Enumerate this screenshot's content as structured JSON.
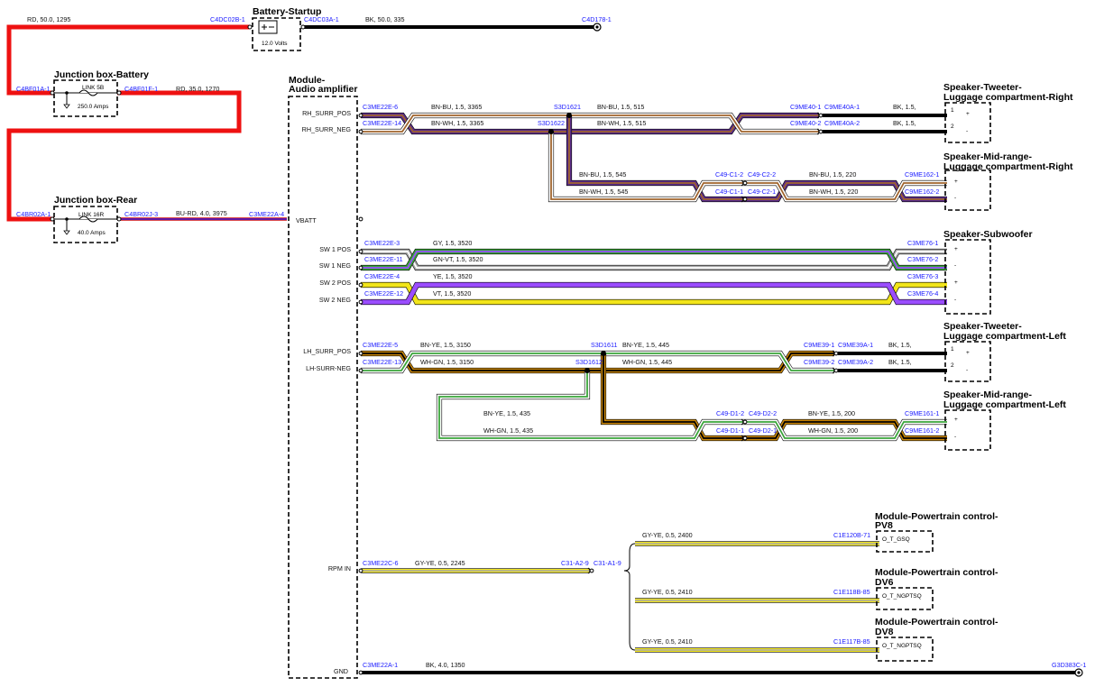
{
  "components": {
    "battery": {
      "title": "Battery-Startup",
      "rating": "12.0 Volts",
      "pin_left": "C4DC02B-1",
      "pin_right": "C4DC03A-1"
    },
    "jb_battery": {
      "title": "Junction box-Battery",
      "link": "LINK 5B",
      "rating": "250.0 Amps",
      "pin_left": "C4BF01A-1",
      "pin_right": "C4BF01F-1"
    },
    "jb_rear": {
      "title": "Junction box-Rear",
      "link": "LINK 16R",
      "rating": "40.0 Amps",
      "pin_left": "C4BR02A-1",
      "pin_right": "C4BR02J-3"
    },
    "amp": {
      "title1": "Module-",
      "title2": "Audio amplifier",
      "pins": [
        "RH_SURR_POS",
        "RH_SURR_NEG",
        "VBATT",
        "SW 1 POS",
        "SW 1 NEG",
        "SW 2 POS",
        "SW 2 NEG",
        "LH_SURR_POS",
        "LH-SURR-NEG",
        "RPM IN",
        "GND"
      ]
    },
    "spk_tw_r": {
      "title1": "Speaker-Tweeter-",
      "title2": "Luggage compartment-Right",
      "p1": "1",
      "p2": "2",
      "plus": "+",
      "minus": "-"
    },
    "spk_mid_r": {
      "title1": "Speaker-Mid-range-",
      "title2": "Luggage compartment-Right",
      "plus": "+",
      "minus": "-"
    },
    "spk_sub": {
      "title1": "Speaker-Subwoofer",
      "plus": "+",
      "minus": "-"
    },
    "spk_tw_l": {
      "title1": "Speaker-Tweeter-",
      "title2": "Luggage compartment-Left",
      "p1": "1",
      "p2": "2",
      "plus": "+",
      "minus": "-"
    },
    "spk_mid_l": {
      "title1": "Speaker-Mid-range-",
      "title2": "Luggage compartment-Left",
      "plus": "+",
      "minus": "-"
    },
    "pcm_pv8": {
      "title1": "Module-Powertrain control-",
      "title2": "PV8",
      "signal": "O_T_GSQ"
    },
    "pcm_dv6": {
      "title1": "Module-Powertrain control-",
      "title2": "DV6",
      "signal": "O_T_NGPTSQ"
    },
    "pcm_dv8": {
      "title1": "Module-Powertrain control-",
      "title2": "DV8",
      "signal": "O_T_NGPTSQ"
    }
  },
  "connectors": {
    "c1": "C4D178-1",
    "c2": "C3ME22A-4",
    "rh_pos": "C3ME22E-6",
    "rh_neg": "C3ME22E-14",
    "s1621": "S3D1621",
    "s1622": "S3D1622",
    "c9me40_1": "C9ME40-1",
    "c9me40a_1": "C9ME40A-1",
    "c9me40_2": "C9ME40-2",
    "c9me40a_2": "C9ME40A-2",
    "c49c1_2": "C49-C1-2",
    "c49c2_2": "C49-C2-2",
    "c49c1_1": "C49-C1-1",
    "c49c2_1": "C49-C2-1",
    "c9me162_1": "C9ME162-1",
    "c9me162_2": "C9ME162-2",
    "sw1p": "C3ME22E-3",
    "sw1n": "C3ME22E-11",
    "sw2p": "C3ME22E-4",
    "sw2n": "C3ME22E-12",
    "c3me76_1": "C3ME76-1",
    "c3me76_2": "C3ME76-2",
    "c3me76_3": "C3ME76-3",
    "c3me76_4": "C3ME76-4",
    "lh_pos": "C3ME22E-5",
    "lh_neg": "C3ME22E-13",
    "s1611": "S3D1611",
    "s1612": "S3D1612",
    "c9me39_1": "C9ME39-1",
    "c9me39a_1": "C9ME39A-1",
    "c9me39_2": "C9ME39-2",
    "c9me39a_2": "C9ME39A-2",
    "c49d1_2": "C49-D1-2",
    "c49d2_2": "C49-D2-2",
    "c49d1_1": "C49-D1-1",
    "c49d2_1": "C49-D2-1",
    "c9me161_1": "C9ME161-1",
    "c9me161_2": "C9ME161-2",
    "rpm": "C3ME22C-6",
    "c31a2": "C31-A2-9",
    "c31a1": "C31-A1-9",
    "c1e120b": "C1E120B-71",
    "c1e118b": "C1E118B-85",
    "c1e117b": "C1E117B-85",
    "gnd": "C3ME22A-1",
    "g3d383c": "G3D383C-1"
  },
  "wires": {
    "w_rd1": "RD,  50.0,  1295",
    "w_bk1": "BK,  50.0,  335",
    "w_rd2": "RD,  35.0,  1270",
    "w_burd": "BU-RD,  4.0,  3975",
    "w_bnbu1": "BN-BU,  1.5,  3365",
    "w_bnwh1": "BN-WH,  1.5,  3365",
    "w_bnbu2": "BN-BU,  1.5,  515",
    "w_bnwh2": "BN-WH,  1.5,  515",
    "w_bk_a": "BK,  1.5,",
    "w_bk_b": "BK,  1.5,",
    "w_bnbu3": "BN-BU,  1.5,  545",
    "w_bnwh3": "BN-WH,  1.5,  545",
    "w_bnbu4": "BN-BU,  1.5,  220",
    "w_bnwh4": "BN-WH,  1.5,  220",
    "w_gy": "GY,  1.5,  3520",
    "w_gnvt": "GN-VT,  1.5,  3520",
    "w_ye": "YE,  1.5,  3520",
    "w_vt": "VT,  1.5,  3520",
    "w_bnye1": "BN-YE,  1.5,  3150",
    "w_whgn1": "WH-GN,  1.5,  3150",
    "w_bnye2": "BN-YE,  1.5,  445",
    "w_whgn2": "WH-GN,  1.5,  445",
    "w_bk_c": "BK,  1.5,",
    "w_bk_d": "BK,  1.5,",
    "w_bnye3": "BN-YE,  1.5,  435",
    "w_whgn3": "WH-GN,  1.5,  435",
    "w_bnye4": "BN-YE,  1.5,  200",
    "w_whgn4": "WH-GN,  1.5,  200",
    "w_gyye1": "GY-YE,  0.5,  2245",
    "w_gyye2": "GY-YE,  0.5,  2400",
    "w_gyye3": "GY-YE,  0.5,  2410",
    "w_gyye4": "GY-YE,  0.5,  2410",
    "w_bk4": "BK,  4.0,  1350"
  },
  "colors": {
    "red": "#ee1111",
    "black": "#000000",
    "blue": "#1a1aff",
    "brown": "#a0642d",
    "purple": "#5b2d8a",
    "white": "#ffffff",
    "grey": "#a8a8a8",
    "green": "#3aa53a",
    "yellow": "#f2e51a",
    "violet": "#9b4dff",
    "orange": "#c8860a"
  }
}
